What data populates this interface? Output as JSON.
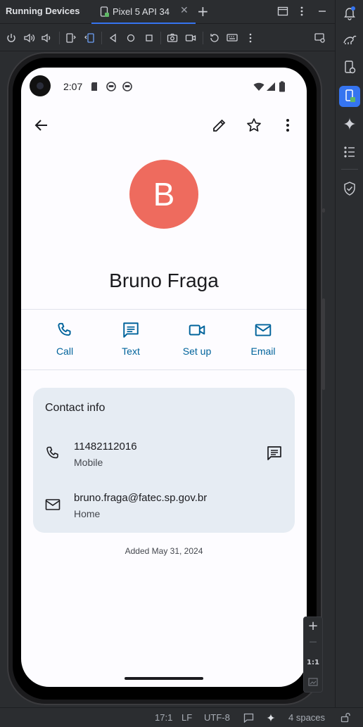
{
  "ide": {
    "tool_window_title": "Running Devices",
    "device_tab_label": "Pixel 5 API 34",
    "tab_close": "✕",
    "tab_add": "+"
  },
  "phone": {
    "status_time": "2:07",
    "contact": {
      "avatar_letter": "B",
      "name": "Bruno Fraga",
      "avatar_color": "#ee6b5e"
    },
    "actions": [
      {
        "label": "Call",
        "icon": "phone-icon"
      },
      {
        "label": "Text",
        "icon": "message-icon"
      },
      {
        "label": "Set up",
        "icon": "video-icon"
      },
      {
        "label": "Email",
        "icon": "email-icon"
      }
    ],
    "contact_info": {
      "title": "Contact info",
      "phone": {
        "value": "11482112016",
        "type": "Mobile"
      },
      "email": {
        "value": "bruno.fraga@fatec.sp.gov.br",
        "type": "Home"
      }
    },
    "added_text": "Added May 31, 2024"
  },
  "zoom": {
    "plus": "+",
    "minus": "—",
    "one_to_one": "1:1"
  },
  "statusbar": {
    "position": "17:1",
    "line_ending": "LF",
    "encoding": "UTF-8",
    "indent": "4 spaces"
  },
  "colors": {
    "accent": "#3574f0",
    "action_blue": "#00639b",
    "card_bg": "#e6ecf3"
  }
}
